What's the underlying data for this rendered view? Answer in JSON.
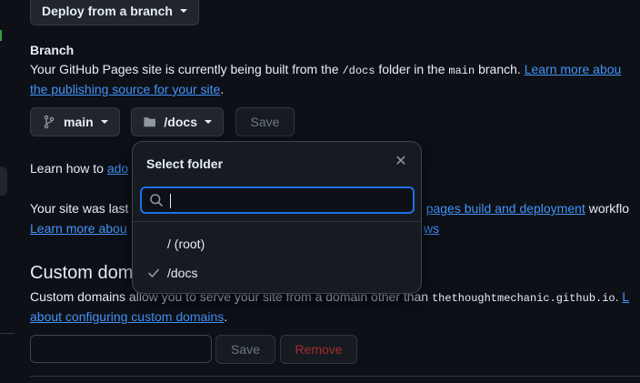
{
  "source": {
    "deploy_button_label": "Deploy from a branch"
  },
  "branch": {
    "heading": "Branch",
    "desc_prefix": "Your GitHub Pages site is currently being built from the ",
    "desc_folder": "/docs",
    "desc_mid": " folder in the ",
    "desc_branch": "main",
    "desc_suffix": " branch. ",
    "learn_more_line1": "Learn more abou",
    "learn_more_line2": "the publishing source for your site",
    "period": ".",
    "branch_button_label": "main",
    "folder_button_label": "/docs",
    "save_label": "Save"
  },
  "learn_how": {
    "prefix": "Learn how to ",
    "link": "ado"
  },
  "last_built": {
    "line1_prefix": "Your site was last",
    "line1_link_prefix": "e ",
    "line1_link": "pages build and deployment",
    "line1_suffix": " workflo",
    "line2_link_prefix": "Learn more abou",
    "line2_link_suffix": "ws"
  },
  "custom_domain": {
    "heading": "Custom dom",
    "desc_prefix": "Custom domains allow you to serve your site from a domain other than ",
    "desc_domain": "thethoughtmechanic.github.io",
    "desc_suffix": ". ",
    "desc_link_tail": "L",
    "link_line2": "about configuring custom domains",
    "period": ".",
    "input_value": "",
    "save_label": "Save",
    "remove_label": "Remove"
  },
  "select_folder": {
    "title": "Select folder",
    "search_value": "",
    "options": [
      {
        "label": "/ (root)",
        "selected": false
      },
      {
        "label": "/docs",
        "selected": true
      }
    ]
  },
  "colors": {
    "background": "#0d1117",
    "link": "#4493f8",
    "focus": "#1f6feb",
    "danger_text": "#a62c2c"
  }
}
